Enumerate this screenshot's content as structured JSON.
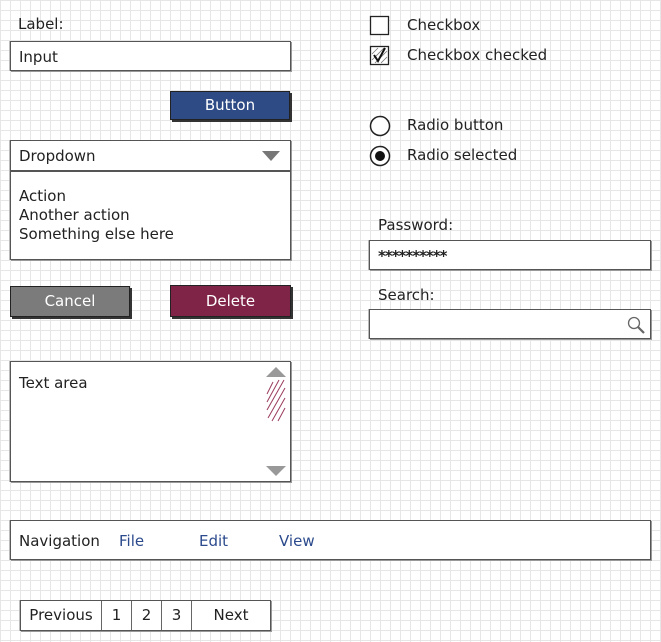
{
  "form": {
    "label": "Label:",
    "input_value": "Input",
    "button_label": "Button",
    "dropdown_value": "Dropdown",
    "dropdown_options": [
      "Action",
      "Another action",
      "Something else here"
    ],
    "cancel_label": "Cancel",
    "delete_label": "Delete",
    "textarea_value": "Text area"
  },
  "checks": {
    "checkbox_label": "Checkbox",
    "checkbox_checked_label": "Checkbox checked",
    "radio_label": "Radio button",
    "radio_selected_label": "Radio selected"
  },
  "fields": {
    "password_label": "Password:",
    "password_value": "**********",
    "search_label": "Search:",
    "search_value": ""
  },
  "nav": {
    "title": "Navigation",
    "items": [
      "File",
      "Edit",
      "View"
    ]
  },
  "pagination": {
    "previous": "Previous",
    "pages": [
      "1",
      "2",
      "3"
    ],
    "next": "Next"
  },
  "colors": {
    "button_blue": "#2e4b85",
    "cancel_gray": "#7b7b7b",
    "delete_maroon": "#7f2447",
    "link_blue": "#2b4a8c"
  }
}
